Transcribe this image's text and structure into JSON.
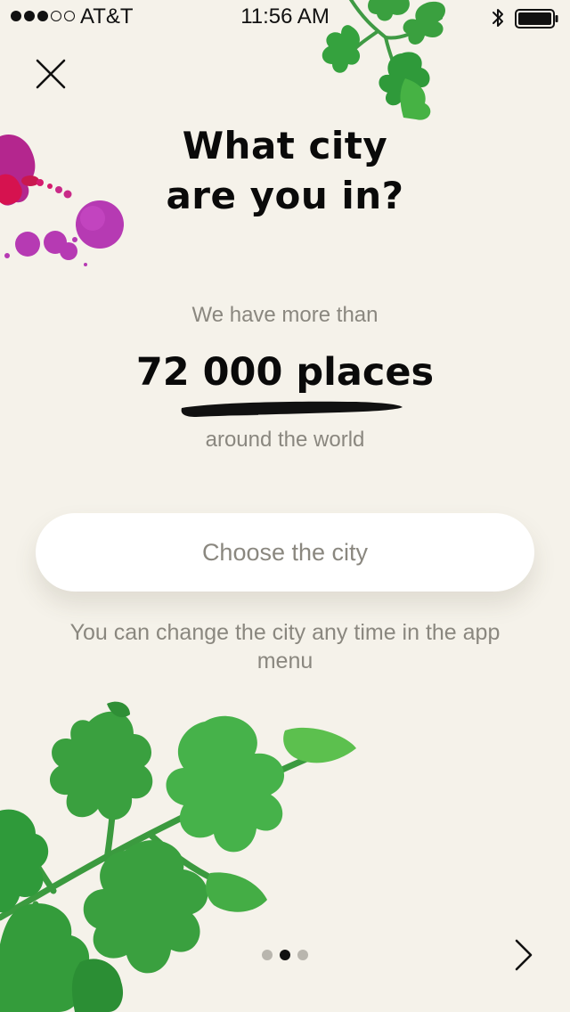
{
  "status_bar": {
    "carrier": "AT&T",
    "time": "11:56 AM",
    "signal_bars_filled": 3,
    "signal_bars_total": 5
  },
  "title": {
    "line1": "What city",
    "line2": "are you in?"
  },
  "stats": {
    "lead": "We have more than",
    "count": "72 000 places",
    "tail": "around the world"
  },
  "city_button": {
    "label": "Choose the city"
  },
  "hint": {
    "text": "You can change the city any time in the app menu"
  },
  "pager": {
    "total": 3,
    "current": 2
  },
  "icons": {
    "close": "close-icon",
    "next": "chevron-right-icon",
    "bluetooth": "bluetooth-icon",
    "battery": "battery-icon"
  },
  "colors": {
    "background": "#f5f2ea",
    "primary_text": "#0a0a0a",
    "secondary_text": "#8a877f",
    "button_bg": "#ffffff",
    "parsley_green": "#3aa03f",
    "berry_magenta": "#b4268e"
  }
}
